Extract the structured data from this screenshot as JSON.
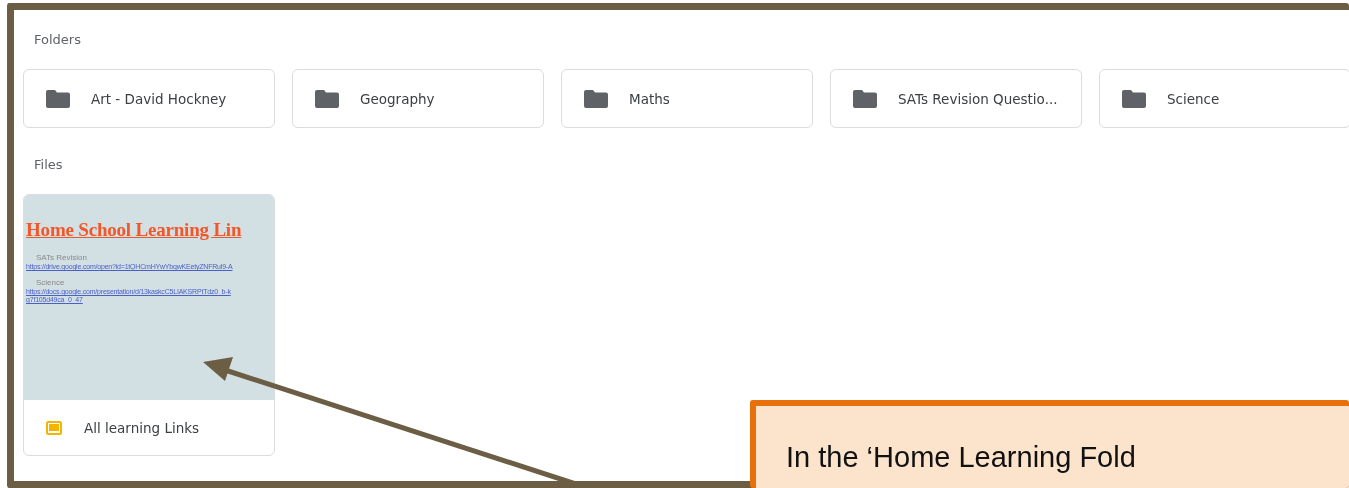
{
  "sections": [
    {
      "label": "Folders"
    },
    {
      "label": "Files"
    }
  ],
  "folders": [
    {
      "name": "Art - David Hockney"
    },
    {
      "name": "Geography"
    },
    {
      "name": "Maths"
    },
    {
      "name": "SATs Revision Questio..."
    },
    {
      "name": "Science"
    }
  ],
  "files": [
    {
      "name": "All learning Links",
      "preview": {
        "title": "Home School Learning Lin",
        "entries": [
          {
            "label": "SATs Revision",
            "links": [
              "https://drive.google.com/open?id=1tQHCmHYwYbqwKEetyZNFRul9-A"
            ]
          },
          {
            "label": "Science",
            "links": [
              "https://docs.google.com/presentation/d/13kaskcC5LIAKSRPtTdz0_b-k",
              "g7f105d49ca_0_47"
            ]
          }
        ]
      }
    }
  ],
  "callout": {
    "text": "In the ‘Home Learning Fold"
  }
}
